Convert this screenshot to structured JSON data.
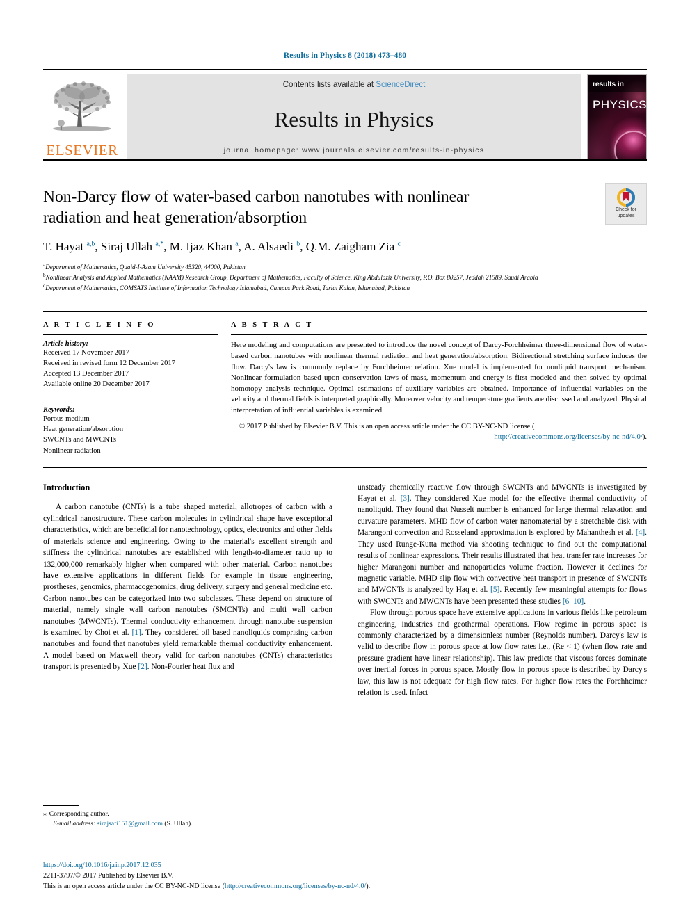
{
  "running_head": "Results in Physics 8 (2018) 473–480",
  "masthead": {
    "contents_prefix": "Contents lists available at ",
    "contents_link": "ScienceDirect",
    "journal_title": "Results in Physics",
    "homepage": "journal homepage: www.journals.elsevier.com/results-in-physics",
    "publisher_wordmark": "ELSEVIER",
    "cover": {
      "line1": "results in",
      "line2": "PHYSICS"
    },
    "colors": {
      "link": "#3f8bbf",
      "elsevier_orange": "#E87722",
      "band_gray": "#e3e3e3"
    }
  },
  "crossmark": {
    "line1": "Check for",
    "line2": "updates"
  },
  "article": {
    "title": "Non-Darcy flow of water-based carbon nanotubes with nonlinear radiation and heat generation/absorption",
    "authors_html": "T. Hayat <sup>a,b</sup>, Siraj Ullah <sup>a,*</sup>, M. Ijaz Khan <sup>a</sup>, A. Alsaedi <sup>b</sup>, Q.M. Zaigham Zia <sup>c</sup>",
    "affiliations": [
      {
        "marker": "a",
        "text": "Department of Mathematics, Quaid-I-Azam University 45320, 44000, Pakistan"
      },
      {
        "marker": "b",
        "text": "Nonlinear Analysis and Applied Mathematics (NAAM) Research Group, Department of Mathematics, Faculty of Science, King Abdulaziz University, P.O. Box 80257, Jeddah 21589, Saudi Arabia"
      },
      {
        "marker": "c",
        "text": "Department of Mathematics, COMSATS Institute of Information Technology Islamabad, Campus Park Road, Tarlai Kalan, Islamabad, Pakistan"
      }
    ]
  },
  "article_info": {
    "heading": "A R T I C L E   I N F O",
    "history_label": "Article history:",
    "history": [
      "Received 17 November 2017",
      "Received in revised form 12 December 2017",
      "Accepted 13 December 2017",
      "Available online 20 December 2017"
    ],
    "keywords_label": "Keywords:",
    "keywords": [
      "Porous medium",
      "Heat generation/absorption",
      "SWCNTs and MWCNTs",
      "Nonlinear radiation"
    ]
  },
  "abstract": {
    "heading": "A B S T R A C T",
    "text": "Here modeling and computations are presented to introduce the novel concept of Darcy-Forchheimer three-dimensional flow of water-based carbon nanotubes with nonlinear thermal radiation and heat generation/absorption. Bidirectional stretching surface induces the flow. Darcy's law is commonly replace by Forchheimer relation. Xue model is implemented for nonliquid transport mechanism. Nonlinear formulation based upon conservation laws of mass, momentum and energy is first modeled and then solved by optimal homotopy analysis technique. Optimal estimations of auxiliary variables are obtained. Importance of influential variables on the velocity and thermal fields is interpreted graphically. Moreover velocity and temperature gradients are discussed and analyzed. Physical interpretation of influential variables is examined.",
    "copyright_lead": "© 2017 Published by Elsevier B.V. This is an open access article under the CC BY-NC-ND license (",
    "copyright_link": "http://creativecommons.org/licenses/by-nc-nd/4.0/",
    "copyright_tail": ")."
  },
  "introduction": {
    "heading": "Introduction",
    "left_paragraph_1": "A carbon nanotube (CNTs) is a tube shaped material, allotropes of carbon with a cylindrical nanostructure. These carbon molecules in cylindrical shape have exceptional characteristics, which are beneficial for nanotechnology, optics, electronics and other fields of materials science and engineering. Owing to the material's excellent strength and stiffness the cylindrical nanotubes are established with length-to-diameter ratio up to 132,000,000 remarkably higher when compared with other material. Carbon nanotubes have extensive applications in different fields for example in tissue engineering, prostheses, genomics, pharmacogenomics, drug delivery, surgery and general medicine etc. Carbon nanotubes can be categorized into two subclasses. These depend on structure of material, namely single wall carbon nanotubes (SMCNTs) and multi wall carbon nanotubes (MWCNTs). Thermal conductivity enhancement through nanotube suspension is examined by Choi et al. [1]. They considered oil based nanoliquids comprising carbon nanotubes and found that nanotubes yield remarkable thermal conductivity enhancement. A model based on Maxwell theory valid for carbon nanotubes (CNTs) characteristics transport is presented by Xue [2]. Non-Fourier heat flux and",
    "right_paragraph_1": "unsteady chemically reactive flow through SWCNTs and MWCNTs is investigated by Hayat et al. [3]. They considered Xue model for the effective thermal conductivity of nanoliquid. They found that Nusselt number is enhanced for large thermal relaxation and curvature parameters. MHD flow of carbon water nanomaterial by a stretchable disk with Marangoni convection and Rosseland approximation is explored by Mahanthesh et al. [4]. They used Runge-Kutta method via shooting technique to find out the computational results of nonlinear expressions. Their results illustrated that heat transfer rate increases for higher Marangoni number and nanoparticles volume fraction. However it declines for magnetic variable. MHD slip flow with convective heat transport in presence of SWCNTs and MWCNTs is analyzed by Haq et al. [5]. Recently few meaningful attempts for flows with SWCNTs and MWCNTs have been presented these studies [6–10].",
    "right_paragraph_2": "Flow through porous space have extensive applications in various fields like petroleum engineering, industries and geothermal operations. Flow regime in porous space is commonly characterized by a dimensionless number (Reynolds number). Darcy's law is valid to describe flow in porous space at low flow rates i.e., (Re < 1) (when flow rate and pressure gradient have linear relationship). This law predicts that viscous forces dominate over inertial forces in porous space. Mostly flow in porous space is described by Darcy's law, this law is not adequate for high flow rates. For higher flow rates the Forchheimer relation is used. Infact",
    "citation_color": "#0b6a9a"
  },
  "footnote": {
    "star": "⁎",
    "corresponding": "Corresponding author.",
    "email_label": "E-mail address:",
    "email": "sirajsafi151@gmail.com",
    "email_owner": "(S. Ullah)."
  },
  "footer": {
    "doi": "https://doi.org/10.1016/j.rinp.2017.12.035",
    "issn_line": "2211-3797/© 2017 Published by Elsevier B.V.",
    "license_prefix": "This is an open access article under the CC BY-NC-ND license (",
    "license_link": "http://creativecommons.org/licenses/by-nc-nd/4.0/",
    "license_tail": ")."
  }
}
